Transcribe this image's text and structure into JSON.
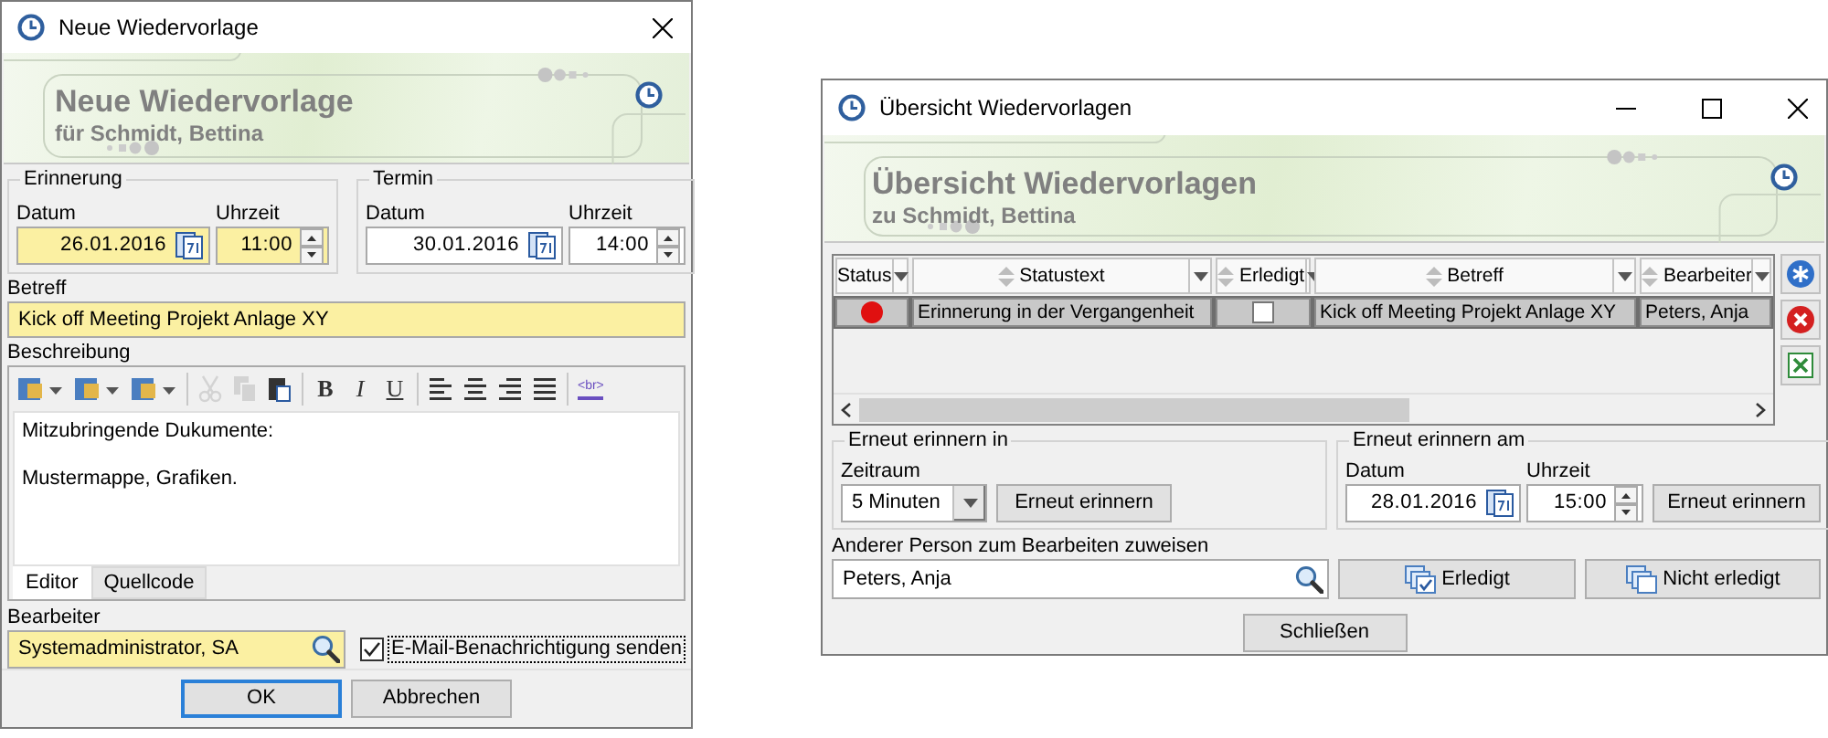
{
  "new_reminder_dialog": {
    "title": "Neue Wiedervorlage",
    "banner": {
      "title": "Neue Wiedervorlage",
      "subtitle": "für Schmidt, Bettina"
    },
    "groups": [
      {
        "legend": "Erinnerung",
        "date_label": "Datum",
        "date": "26.01.2016",
        "time_label": "Uhrzeit",
        "time": "11:00",
        "required": true
      },
      {
        "legend": "Termin",
        "date_label": "Datum",
        "date": "30.01.2016",
        "time_label": "Uhrzeit",
        "time": "14:00",
        "required": false
      }
    ],
    "subject": {
      "label": "Betreff",
      "value": "Kick off Meeting Projekt Anlage XY",
      "required": true
    },
    "description": {
      "label": "Beschreibung",
      "toolbar": [
        {
          "kind": "menu",
          "disabled": false
        },
        {
          "kind": "menu",
          "disabled": false
        },
        {
          "kind": "menu",
          "disabled": false
        },
        {
          "kind": "separator"
        },
        {
          "kind": "cut",
          "disabled": true
        },
        {
          "kind": "copy",
          "disabled": true
        },
        {
          "kind": "paste",
          "disabled": false
        },
        {
          "kind": "separator"
        },
        {
          "kind": "bold",
          "label": "B",
          "disabled": false
        },
        {
          "kind": "italic",
          "label": "I",
          "disabled": false
        },
        {
          "kind": "underline",
          "label": "U",
          "disabled": false
        },
        {
          "kind": "separator"
        },
        {
          "kind": "align-left",
          "disabled": false
        },
        {
          "kind": "align-center",
          "disabled": false
        },
        {
          "kind": "align-right",
          "disabled": false
        },
        {
          "kind": "justify",
          "disabled": false
        },
        {
          "kind": "separator"
        },
        {
          "kind": "html",
          "label": "<br>",
          "disabled": false
        }
      ],
      "paragraphs": [
        "Mitzubringende Dukumente:",
        "Mustermappe, Grafiken."
      ],
      "tabs": [
        {
          "label": "Editor",
          "selected": true
        },
        {
          "label": "Quellcode",
          "selected": false
        }
      ]
    },
    "assignee": {
      "label": "Bearbeiter",
      "value": "Systemadministrator, SA",
      "required": true
    },
    "email_checkbox": {
      "label": "E-Mail-Benachrichtigung senden",
      "checked": true
    },
    "buttons": [
      {
        "label": "OK",
        "default": true
      },
      {
        "label": "Abbrechen",
        "default": false
      }
    ]
  },
  "overview_dialog": {
    "title": "Übersicht Wiedervorlagen",
    "banner": {
      "title": "Übersicht Wiedervorlagen",
      "subtitle": "zu Schmidt, Bettina"
    },
    "table": {
      "columns": [
        {
          "label": "Status",
          "sortable": false
        },
        {
          "label": "Statustext",
          "sortable": true
        },
        {
          "label": "Erledigt",
          "sortable": true
        },
        {
          "label": "Betreff",
          "sortable": true
        },
        {
          "label": "Bearbeiter",
          "sortable": true
        }
      ],
      "rows": [
        {
          "selected": true,
          "cells": [
            {
              "kind": "status",
              "color": "#e01010"
            },
            {
              "kind": "text",
              "text": "Erinnerung in der Vergangenheit"
            },
            {
              "kind": "checkbox",
              "checked": false
            },
            {
              "kind": "text",
              "text": "Kick off Meeting Projekt Anlage XY"
            },
            {
              "kind": "text",
              "text": "Peters, Anja"
            }
          ]
        }
      ]
    },
    "remind_in": {
      "legend": "Erneut erinnern in",
      "label": "Zeitraum",
      "value": "5 Minuten",
      "button": "Erneut erinnern"
    },
    "remind_at": {
      "legend": "Erneut erinnern am",
      "date_label": "Datum",
      "date": "28.01.2016",
      "time_label": "Uhrzeit",
      "time": "15:00",
      "button": "Erneut erinnern"
    },
    "reassign": {
      "label": "Anderer Person zum Bearbeiten zuweisen",
      "value": "Peters, Anja",
      "buttons": [
        {
          "kind": "done",
          "label": "Erledigt"
        },
        {
          "kind": "undone",
          "label": "Nicht erledigt"
        }
      ]
    },
    "close_button": "Schließen"
  }
}
